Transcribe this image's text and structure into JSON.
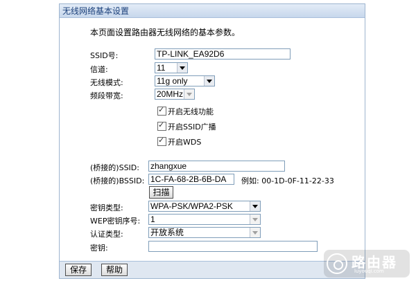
{
  "panel": {
    "title": "无线网络基本设置",
    "description": "本页面设置路由器无线网络的基本参数。"
  },
  "fields": {
    "ssid": {
      "label": "SSID号:",
      "value": "TP-LINK_EA92D6"
    },
    "channel": {
      "label": "信道:",
      "value": "11"
    },
    "mode": {
      "label": "无线模式:",
      "value": "11g only"
    },
    "bandwidth": {
      "label": "频段带宽:",
      "value": "20MHz"
    }
  },
  "checkboxes": {
    "enable_wireless": "开启无线功能",
    "enable_ssid_broadcast": "开启SSID广播",
    "enable_wds": "开启WDS"
  },
  "wds": {
    "bridge_ssid": {
      "label": "(桥接的)SSID:",
      "value": "zhangxue"
    },
    "bridge_bssid": {
      "label": "(桥接的)BSSID:",
      "value": "1C-FA-68-2B-6B-DA"
    },
    "example": "例如: 00-1D-0F-11-22-33",
    "scan_label": "扫描",
    "key_type": {
      "label": "密钥类型:",
      "value": "WPA-PSK/WPA2-PSK"
    },
    "wep_index": {
      "label": "WEP密钥序号:",
      "value": "1"
    },
    "auth_type": {
      "label": "认证类型:",
      "value": "开放系统"
    },
    "key": {
      "label": "密钥:",
      "value": ""
    }
  },
  "footer": {
    "save_label": "保存",
    "help_label": "帮助"
  },
  "watermark": {
    "title": "路由器",
    "subtitle": "luyouqi.com"
  }
}
